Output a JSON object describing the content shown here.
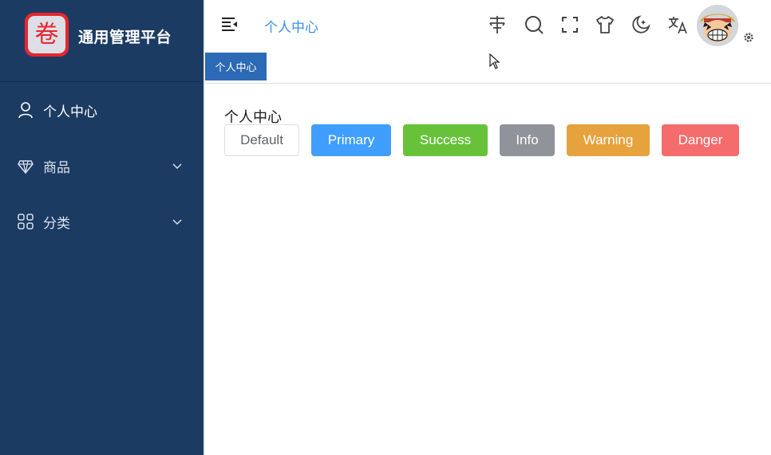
{
  "brand": {
    "logo_char": "卷",
    "title": "通用管理平台",
    "logo_color": "#e7262f"
  },
  "sidebar": {
    "bg": "#1c3b63",
    "items": [
      {
        "label": "个人中心",
        "icon": "user-icon",
        "active": true
      },
      {
        "label": "商品",
        "icon": "goods-icon",
        "expandable": true
      },
      {
        "label": "分类",
        "icon": "grid-icon",
        "expandable": true
      }
    ]
  },
  "header": {
    "breadcrumb": "个人中心",
    "tools": [
      "signpost-icon",
      "search-icon",
      "fullscreen-icon",
      "tshirt-icon",
      "moon-icon",
      "translate-icon"
    ]
  },
  "tags": [
    {
      "label": "个人中心",
      "active": true
    }
  ],
  "main": {
    "title": "个人中心",
    "buttons": [
      {
        "label": "Default",
        "type": "default"
      },
      {
        "label": "Primary",
        "type": "primary",
        "color": "#409eff"
      },
      {
        "label": "Success",
        "type": "success",
        "color": "#67c23a"
      },
      {
        "label": "Info",
        "type": "info",
        "color": "#909399"
      },
      {
        "label": "Warning",
        "type": "warning",
        "color": "#e6a23c"
      },
      {
        "label": "Danger",
        "type": "danger",
        "color": "#f56c6c"
      }
    ]
  }
}
